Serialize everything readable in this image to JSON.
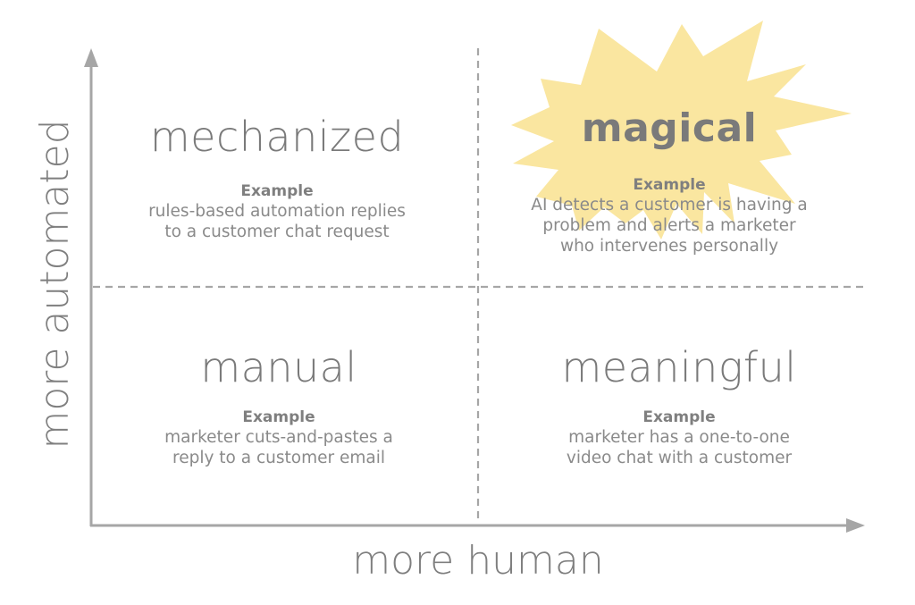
{
  "diagram": {
    "type": "2x2 quadrant",
    "axes": {
      "y_label": "more automated",
      "x_label": "more human"
    },
    "highlight_color": "#fae6a0",
    "axis_color": "#a6a6a6",
    "quadrants": {
      "top_left": {
        "title": "mechanized",
        "example_label": "Example",
        "example_lines": [
          "rules-based automation replies",
          "to a customer chat request"
        ]
      },
      "top_right": {
        "title": "magical",
        "highlighted": true,
        "example_label": "Example",
        "example_lines": [
          "AI detects a customer is having a",
          "problem and alerts a marketer",
          "who intervenes personally"
        ]
      },
      "bottom_left": {
        "title": "manual",
        "example_label": "Example",
        "example_lines": [
          "marketer cuts-and-pastes a",
          "reply to a customer email"
        ]
      },
      "bottom_right": {
        "title": "meaningful",
        "example_label": "Example",
        "example_lines": [
          "marketer has a one-to-one",
          "video chat with a customer"
        ]
      }
    }
  }
}
